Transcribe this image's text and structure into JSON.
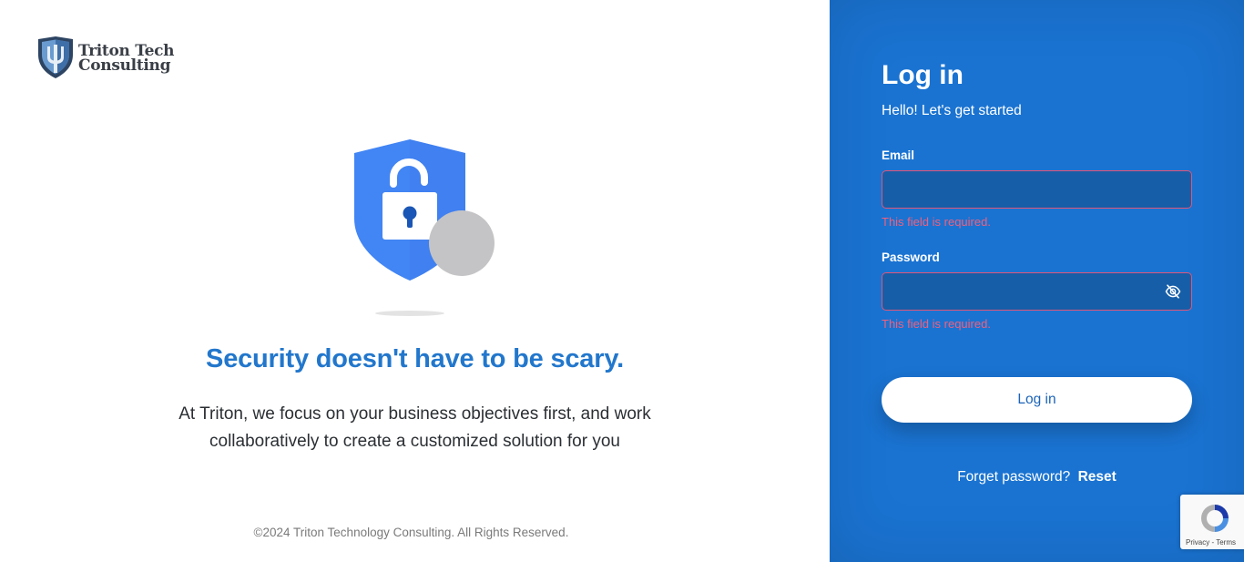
{
  "brand": {
    "name_line1": "Triton Tech",
    "name_line2": "Consulting"
  },
  "hero": {
    "headline": "Security doesn't have to be scary.",
    "desc_line1": "At Triton, we focus on your business objectives first, and work",
    "desc_line2": "collaboratively to create a customized solution for you"
  },
  "footer": {
    "copyright": "©2024 Triton Technology Consulting. All Rights Reserved."
  },
  "login": {
    "title": "Log in",
    "subtitle": "Hello! Let's get started",
    "email_label": "Email",
    "email_value": "",
    "email_error": "This field is required.",
    "password_label": "Password",
    "password_value": "",
    "password_error": "This field is required.",
    "submit_label": "Log in",
    "forgot_text": "Forget password?",
    "reset_link": "Reset"
  },
  "recaptcha": {
    "privacy": "Privacy",
    "separator": " - ",
    "terms": "Terms"
  },
  "colors": {
    "accent": "#2277cc",
    "panel": "#1a73d1",
    "input_bg": "#165ea8",
    "error": "#f0607e",
    "shield": "#4285f4"
  },
  "icons": {
    "logo": "trident-shield-logo",
    "hero": "unlocked-shield-icon",
    "password_toggle": "eye-slash-icon",
    "captcha": "recaptcha-icon"
  }
}
